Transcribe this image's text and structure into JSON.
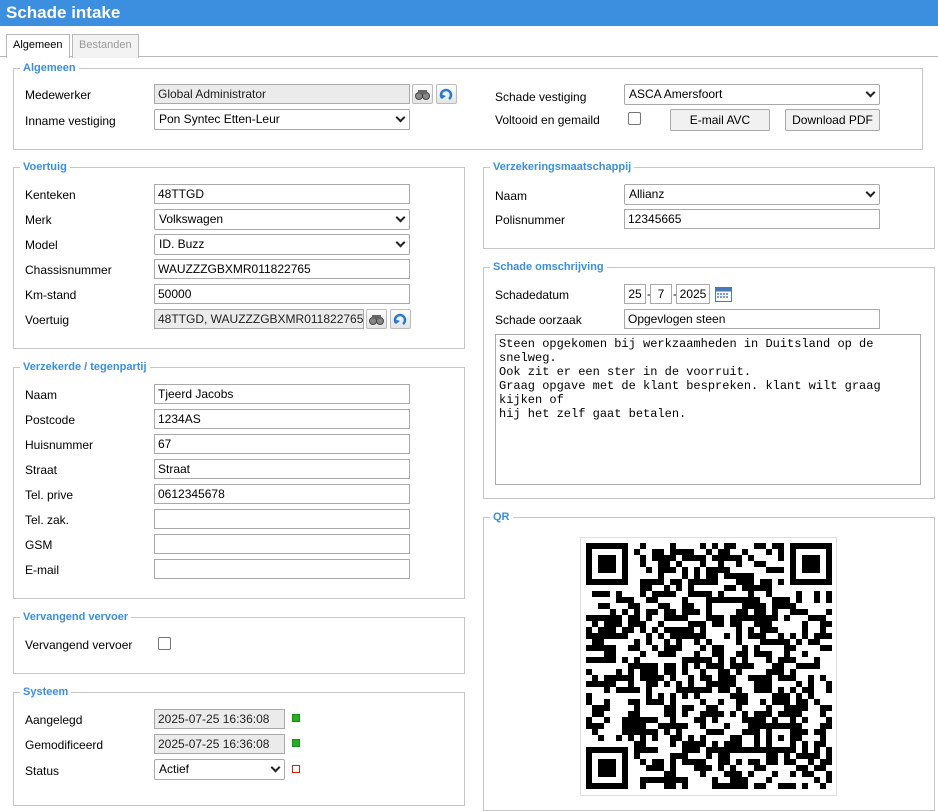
{
  "window": {
    "title": "Schade intake"
  },
  "tabs": [
    {
      "label": "Algemeen",
      "active": true
    },
    {
      "label": "Bestanden",
      "active": false
    }
  ],
  "algemeen": {
    "legend": "Algemeen",
    "medewerker_label": "Medewerker",
    "medewerker_value": "Global Administrator",
    "inname_label": "Inname vestiging",
    "inname_value": "Pon Syntec Etten-Leur",
    "schade_vestiging_label": "Schade vestiging",
    "schade_vestiging_value": "ASCA Amersfoort",
    "voltooid_label": "Voltooid en gemaild",
    "email_button": "E-mail AVC",
    "download_button": "Download PDF"
  },
  "voertuig": {
    "legend": "Voertuig",
    "kenteken_label": "Kenteken",
    "kenteken_value": "48TTGD",
    "merk_label": "Merk",
    "merk_value": "Volkswagen",
    "model_label": "Model",
    "model_value": "ID. Buzz",
    "chassis_label": "Chassisnummer",
    "chassis_value": "WAUZZZGBXMR011822765",
    "km_label": "Km-stand",
    "km_value": "50000",
    "voertuig_label": "Voertuig",
    "voertuig_value": "48TTGD, WAUZZZGBXMR011822765"
  },
  "verzekerde": {
    "legend": "Verzekerde / tegenpartij",
    "naam_label": "Naam",
    "naam_value": "Tjeerd Jacobs",
    "postcode_label": "Postcode",
    "postcode_value": "1234AS",
    "huisnummer_label": "Huisnummer",
    "huisnummer_value": "67",
    "straat_label": "Straat",
    "straat_value": "Straat",
    "telprive_label": "Tel. prive",
    "telprive_value": "0612345678",
    "telzak_label": "Tel. zak.",
    "telzak_value": "",
    "gsm_label": "GSM",
    "gsm_value": "",
    "email_label": "E-mail",
    "email_value": ""
  },
  "vervangend": {
    "legend": "Vervangend vervoer",
    "label": "Vervangend vervoer"
  },
  "systeem": {
    "legend": "Systeem",
    "aangelegd_label": "Aangelegd",
    "aangelegd_value": "2025-07-25 16:36:08",
    "gemodificeerd_label": "Gemodificeerd",
    "gemodificeerd_value": "2025-07-25 16:36:08",
    "status_label": "Status",
    "status_value": "Actief"
  },
  "verzekering": {
    "legend": "Verzekeringsmaatschappij",
    "naam_label": "Naam",
    "naam_value": "Allianz",
    "polis_label": "Polisnummer",
    "polis_value": "12345665"
  },
  "omschrijving": {
    "legend": "Schade omschrijving",
    "datum_label": "Schadedatum",
    "day": "25",
    "month": "7",
    "year": "2025",
    "oorzaak_label": "Schade oorzaak",
    "oorzaak_value": "Opgevlogen steen",
    "text": "Steen opgekomen bij werkzaamheden in Duitsland op de snelweg.\nOok zit er een ster in de voorruit.\nGraag opgave met de klant bespreken. klant wilt graag kijken of\nhij het zelf gaat betalen."
  },
  "qr": {
    "legend": "QR"
  },
  "colors": {
    "accent": "#3c8ede",
    "status_ok": "#22b022",
    "status_off": "#d42020"
  }
}
